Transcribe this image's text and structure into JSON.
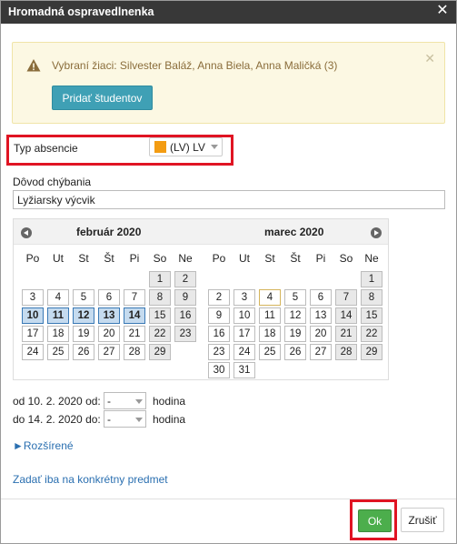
{
  "dialog": {
    "title": "Hromadná ospravedlnenka"
  },
  "alert": {
    "message": "Vybraní žiaci: Silvester Baláž, Anna Biela, Anna Maličká (3)",
    "add_button": "Pridať študentov"
  },
  "absence_type": {
    "label": "Typ absencie",
    "value": "(LV) LV",
    "color": "#f39c12"
  },
  "reason": {
    "label": "Dôvod chýbania",
    "value": "Lyžiarsky výcvik"
  },
  "calendar": {
    "weekdays": [
      "Po",
      "Ut",
      "St",
      "Št",
      "Pi",
      "So",
      "Ne"
    ],
    "months": [
      {
        "title": "február 2020",
        "weeks": [
          [
            "",
            "",
            "",
            "",
            "",
            "1",
            "2"
          ],
          [
            "3",
            "4",
            "5",
            "6",
            "7",
            "8",
            "9"
          ],
          [
            "10",
            "11",
            "12",
            "13",
            "14",
            "15",
            "16"
          ],
          [
            "17",
            "18",
            "19",
            "20",
            "21",
            "22",
            "23"
          ],
          [
            "24",
            "25",
            "26",
            "27",
            "28",
            "29",
            ""
          ]
        ],
        "selected": [
          "10",
          "11",
          "12",
          "13",
          "14"
        ]
      },
      {
        "title": "marec 2020",
        "weeks": [
          [
            "",
            "",
            "",
            "",
            "",
            "",
            "1"
          ],
          [
            "2",
            "3",
            "4",
            "5",
            "6",
            "7",
            "8"
          ],
          [
            "9",
            "10",
            "11",
            "12",
            "13",
            "14",
            "15"
          ],
          [
            "16",
            "17",
            "18",
            "19",
            "20",
            "21",
            "22"
          ],
          [
            "23",
            "24",
            "25",
            "26",
            "27",
            "28",
            "29"
          ],
          [
            "30",
            "31",
            "",
            "",
            "",
            "",
            ""
          ]
        ],
        "today": "4"
      }
    ]
  },
  "from": {
    "label": "od 10. 2. 2020 od:",
    "value": "-",
    "unit": "hodina"
  },
  "to": {
    "label": "do 14. 2. 2020 do:",
    "value": "-",
    "unit": "hodina"
  },
  "links": {
    "advanced": "►Rozšírené",
    "subject": "Zadať iba na konkrétny predmet"
  },
  "buttons": {
    "ok": "Ok",
    "cancel": "Zrušiť"
  },
  "icons": {
    "close": "close-icon",
    "warning": "warning-icon",
    "prev": "prev-month-icon",
    "next": "next-month-icon"
  }
}
